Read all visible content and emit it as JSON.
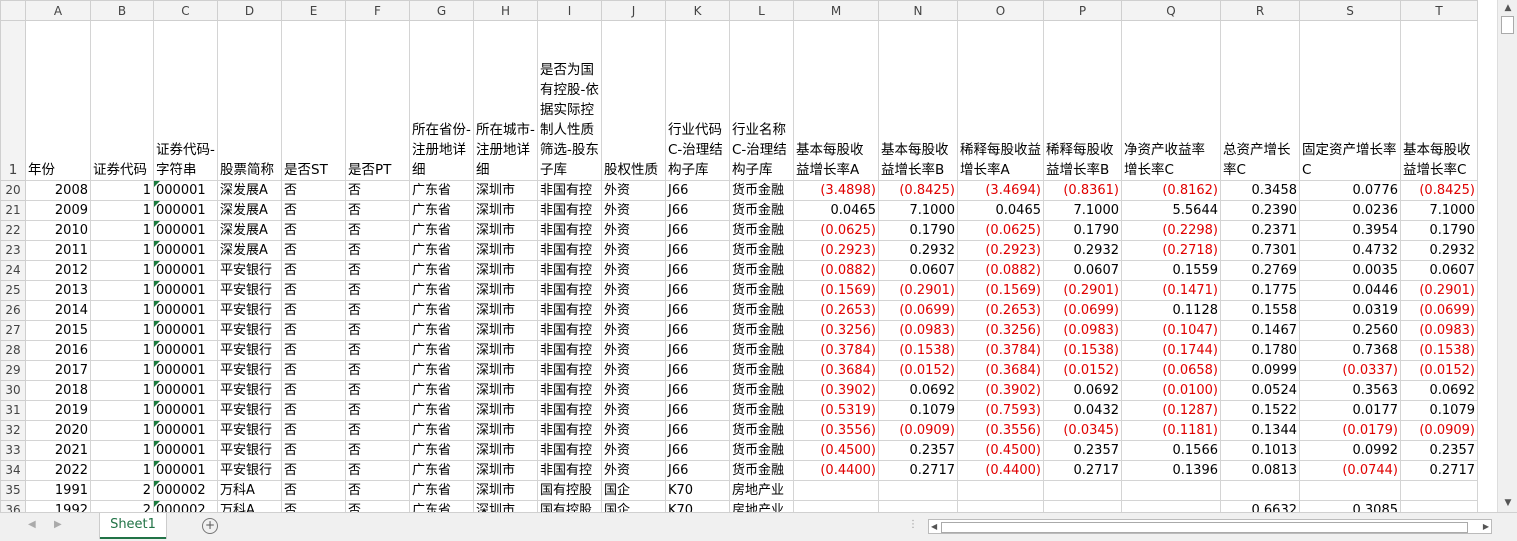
{
  "columns": [
    "A",
    "B",
    "C",
    "D",
    "E",
    "F",
    "G",
    "H",
    "I",
    "J",
    "K",
    "L",
    "M",
    "N",
    "O",
    "P",
    "Q",
    "R",
    "S",
    "T"
  ],
  "header_row": {
    "row_num": "1",
    "labels": [
      "年份",
      "证券代码",
      "证券代码-字符串",
      "股票简称",
      "是否ST",
      "是否PT",
      "所在省份-注册地详细",
      "所在城市-注册地详细",
      "是否为国有控股-依据实际控制人性质筛选-股东子库",
      "股权性质",
      "行业代码C-治理结构子库",
      "行业名称C-治理结构子库",
      "基本每股收益增长率A",
      "基本每股收益增长率B",
      "稀释每股收益增长率A",
      "稀释每股收益增长率B",
      "净资产收益率增长率C",
      "总资产增长率C",
      "固定资产增长率C",
      "基本每股收益增长率C"
    ]
  },
  "rows": [
    {
      "n": "20",
      "year": "2008",
      "code": "1",
      "codestr": "000001",
      "name": "深发展A",
      "st": "否",
      "pt": "否",
      "prov": "广东省",
      "city": "深圳市",
      "soe": "非国有控",
      "equity": "外资",
      "ind": "J66",
      "indname": "货币金融",
      "m": "(3.4898)",
      "nn": "(0.8425)",
      "o": "(3.4694)",
      "p": "(0.8361)",
      "q": "(0.8162)",
      "r": "0.3458",
      "s": "0.0776",
      "t": "(0.8425)"
    },
    {
      "n": "21",
      "year": "2009",
      "code": "1",
      "codestr": "000001",
      "name": "深发展A",
      "st": "否",
      "pt": "否",
      "prov": "广东省",
      "city": "深圳市",
      "soe": "非国有控",
      "equity": "外资",
      "ind": "J66",
      "indname": "货币金融",
      "m": "0.0465",
      "nn": "7.1000",
      "o": "0.0465",
      "p": "7.1000",
      "q": "5.5644",
      "r": "0.2390",
      "s": "0.0236",
      "t": "7.1000"
    },
    {
      "n": "22",
      "year": "2010",
      "code": "1",
      "codestr": "000001",
      "name": "深发展A",
      "st": "否",
      "pt": "否",
      "prov": "广东省",
      "city": "深圳市",
      "soe": "非国有控",
      "equity": "外资",
      "ind": "J66",
      "indname": "货币金融",
      "m": "(0.0625)",
      "nn": "0.1790",
      "o": "(0.0625)",
      "p": "0.1790",
      "q": "(0.2298)",
      "r": "0.2371",
      "s": "0.3954",
      "t": "0.1790"
    },
    {
      "n": "23",
      "year": "2011",
      "code": "1",
      "codestr": "000001",
      "name": "深发展A",
      "st": "否",
      "pt": "否",
      "prov": "广东省",
      "city": "深圳市",
      "soe": "非国有控",
      "equity": "外资",
      "ind": "J66",
      "indname": "货币金融",
      "m": "(0.2923)",
      "nn": "0.2932",
      "o": "(0.2923)",
      "p": "0.2932",
      "q": "(0.2718)",
      "r": "0.7301",
      "s": "0.4732",
      "t": "0.2932"
    },
    {
      "n": "24",
      "year": "2012",
      "code": "1",
      "codestr": "000001",
      "name": "平安银行",
      "st": "否",
      "pt": "否",
      "prov": "广东省",
      "city": "深圳市",
      "soe": "非国有控",
      "equity": "外资",
      "ind": "J66",
      "indname": "货币金融",
      "m": "(0.0882)",
      "nn": "0.0607",
      "o": "(0.0882)",
      "p": "0.0607",
      "q": "0.1559",
      "r": "0.2769",
      "s": "0.0035",
      "t": "0.0607"
    },
    {
      "n": "25",
      "year": "2013",
      "code": "1",
      "codestr": "000001",
      "name": "平安银行",
      "st": "否",
      "pt": "否",
      "prov": "广东省",
      "city": "深圳市",
      "soe": "非国有控",
      "equity": "外资",
      "ind": "J66",
      "indname": "货币金融",
      "m": "(0.1569)",
      "nn": "(0.2901)",
      "o": "(0.1569)",
      "p": "(0.2901)",
      "q": "(0.1471)",
      "r": "0.1775",
      "s": "0.0446",
      "t": "(0.2901)"
    },
    {
      "n": "26",
      "year": "2014",
      "code": "1",
      "codestr": "000001",
      "name": "平安银行",
      "st": "否",
      "pt": "否",
      "prov": "广东省",
      "city": "深圳市",
      "soe": "非国有控",
      "equity": "外资",
      "ind": "J66",
      "indname": "货币金融",
      "m": "(0.2653)",
      "nn": "(0.0699)",
      "o": "(0.2653)",
      "p": "(0.0699)",
      "q": "0.1128",
      "r": "0.1558",
      "s": "0.0319",
      "t": "(0.0699)"
    },
    {
      "n": "27",
      "year": "2015",
      "code": "1",
      "codestr": "000001",
      "name": "平安银行",
      "st": "否",
      "pt": "否",
      "prov": "广东省",
      "city": "深圳市",
      "soe": "非国有控",
      "equity": "外资",
      "ind": "J66",
      "indname": "货币金融",
      "m": "(0.3256)",
      "nn": "(0.0983)",
      "o": "(0.3256)",
      "p": "(0.0983)",
      "q": "(0.1047)",
      "r": "0.1467",
      "s": "0.2560",
      "t": "(0.0983)"
    },
    {
      "n": "28",
      "year": "2016",
      "code": "1",
      "codestr": "000001",
      "name": "平安银行",
      "st": "否",
      "pt": "否",
      "prov": "广东省",
      "city": "深圳市",
      "soe": "非国有控",
      "equity": "外资",
      "ind": "J66",
      "indname": "货币金融",
      "m": "(0.3784)",
      "nn": "(0.1538)",
      "o": "(0.3784)",
      "p": "(0.1538)",
      "q": "(0.1744)",
      "r": "0.1780",
      "s": "0.7368",
      "t": "(0.1538)"
    },
    {
      "n": "29",
      "year": "2017",
      "code": "1",
      "codestr": "000001",
      "name": "平安银行",
      "st": "否",
      "pt": "否",
      "prov": "广东省",
      "city": "深圳市",
      "soe": "非国有控",
      "equity": "外资",
      "ind": "J66",
      "indname": "货币金融",
      "m": "(0.3684)",
      "nn": "(0.0152)",
      "o": "(0.3684)",
      "p": "(0.0152)",
      "q": "(0.0658)",
      "r": "0.0999",
      "s": "(0.0337)",
      "t": "(0.0152)"
    },
    {
      "n": "30",
      "year": "2018",
      "code": "1",
      "codestr": "000001",
      "name": "平安银行",
      "st": "否",
      "pt": "否",
      "prov": "广东省",
      "city": "深圳市",
      "soe": "非国有控",
      "equity": "外资",
      "ind": "J66",
      "indname": "货币金融",
      "m": "(0.3902)",
      "nn": "0.0692",
      "o": "(0.3902)",
      "p": "0.0692",
      "q": "(0.0100)",
      "r": "0.0524",
      "s": "0.3563",
      "t": "0.0692"
    },
    {
      "n": "31",
      "year": "2019",
      "code": "1",
      "codestr": "000001",
      "name": "平安银行",
      "st": "否",
      "pt": "否",
      "prov": "广东省",
      "city": "深圳市",
      "soe": "非国有控",
      "equity": "外资",
      "ind": "J66",
      "indname": "货币金融",
      "m": "(0.5319)",
      "nn": "0.1079",
      "o": "(0.7593)",
      "p": "0.0432",
      "q": "(0.1287)",
      "r": "0.1522",
      "s": "0.0177",
      "t": "0.1079"
    },
    {
      "n": "32",
      "year": "2020",
      "code": "1",
      "codestr": "000001",
      "name": "平安银行",
      "st": "否",
      "pt": "否",
      "prov": "广东省",
      "city": "深圳市",
      "soe": "非国有控",
      "equity": "外资",
      "ind": "J66",
      "indname": "货币金融",
      "m": "(0.3556)",
      "nn": "(0.0909)",
      "o": "(0.3556)",
      "p": "(0.0345)",
      "q": "(0.1181)",
      "r": "0.1344",
      "s": "(0.0179)",
      "t": "(0.0909)"
    },
    {
      "n": "33",
      "year": "2021",
      "code": "1",
      "codestr": "000001",
      "name": "平安银行",
      "st": "否",
      "pt": "否",
      "prov": "广东省",
      "city": "深圳市",
      "soe": "非国有控",
      "equity": "外资",
      "ind": "J66",
      "indname": "货币金融",
      "m": "(0.4500)",
      "nn": "0.2357",
      "o": "(0.4500)",
      "p": "0.2357",
      "q": "0.1566",
      "r": "0.1013",
      "s": "0.0992",
      "t": "0.2357"
    },
    {
      "n": "34",
      "year": "2022",
      "code": "1",
      "codestr": "000001",
      "name": "平安银行",
      "st": "否",
      "pt": "否",
      "prov": "广东省",
      "city": "深圳市",
      "soe": "非国有控",
      "equity": "外资",
      "ind": "J66",
      "indname": "货币金融",
      "m": "(0.4400)",
      "nn": "0.2717",
      "o": "(0.4400)",
      "p": "0.2717",
      "q": "0.1396",
      "r": "0.0813",
      "s": "(0.0744)",
      "t": "0.2717"
    },
    {
      "n": "35",
      "year": "1991",
      "code": "2",
      "codestr": "000002",
      "name": "万科A",
      "st": "否",
      "pt": "否",
      "prov": "广东省",
      "city": "深圳市",
      "soe": "国有控股",
      "equity": "国企",
      "ind": "K70",
      "indname": "房地产业",
      "m": "",
      "nn": "",
      "o": "",
      "p": "",
      "q": "",
      "r": "",
      "s": "",
      "t": ""
    },
    {
      "n": "36",
      "year": "1992",
      "code": "2",
      "codestr": "000002",
      "name": "万科A",
      "st": "否",
      "pt": "否",
      "prov": "广东省",
      "city": "深圳市",
      "soe": "国有控股",
      "equity": "国企",
      "ind": "K70",
      "indname": "房地产业",
      "m": "",
      "nn": "",
      "o": "",
      "p": "",
      "q": "",
      "r": "0.6632",
      "s": "0.3085",
      "t": ""
    }
  ],
  "tabs": {
    "active": "Sheet1",
    "add_label": "+"
  },
  "colors": {
    "negative": "#e00000",
    "tab_accent": "#217346"
  }
}
